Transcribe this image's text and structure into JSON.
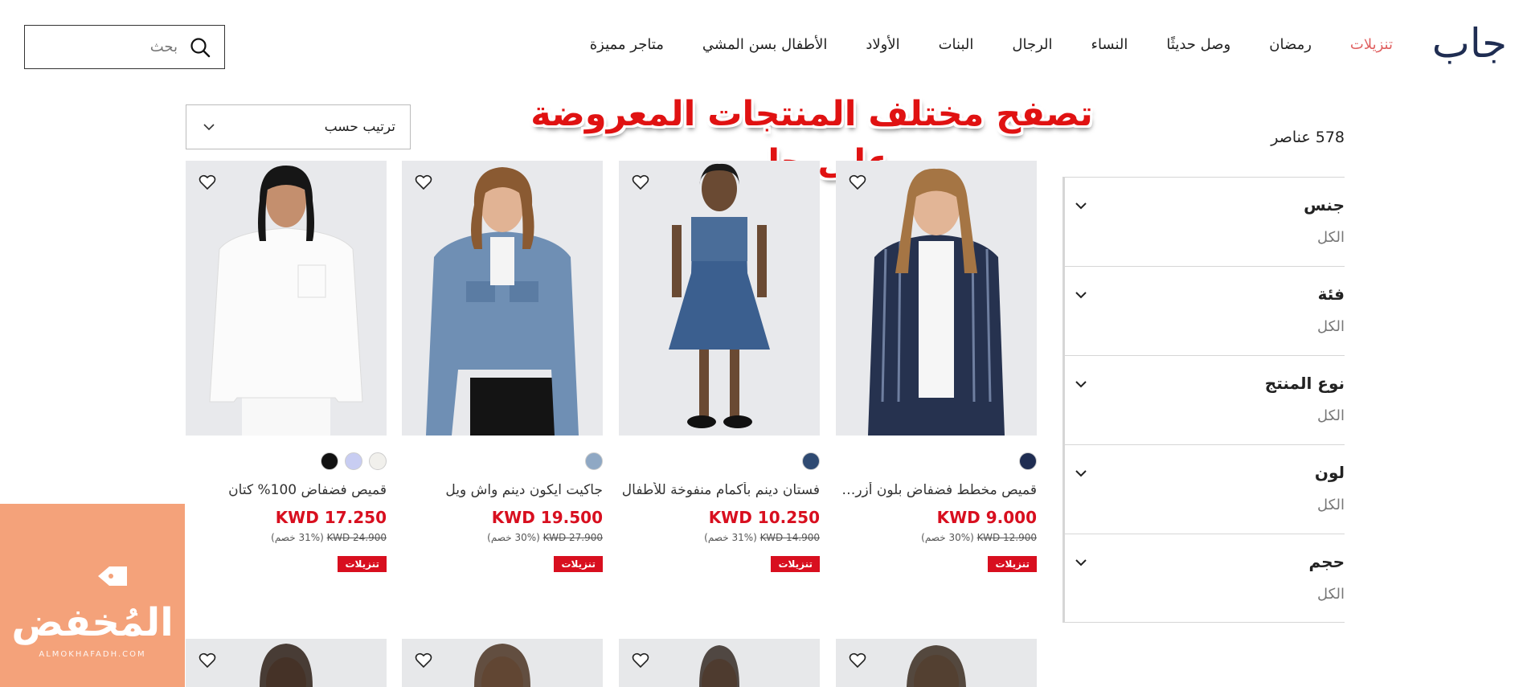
{
  "header": {
    "logo": "جاب",
    "nav": [
      {
        "label": "تنزيلات",
        "accent": "#e06060"
      },
      {
        "label": "رمضان"
      },
      {
        "label": "وصل حديثًا"
      },
      {
        "label": "النساء"
      },
      {
        "label": "الرجال"
      },
      {
        "label": "البنات"
      },
      {
        "label": "الأولاد"
      },
      {
        "label": "الأطفال بسن المشي"
      },
      {
        "label": "متاجر مميزة"
      }
    ],
    "search": {
      "placeholder": "بحث",
      "icon": "search-icon"
    }
  },
  "banner": {
    "text": "تصفح مختلف المنتجات المعروضة على جاب",
    "color": "#e01212"
  },
  "sort": {
    "label": "ترتيب حسب",
    "icon": "chevron-down-icon"
  },
  "results": {
    "count": "578 عناصر"
  },
  "filters": [
    {
      "title": "جنس",
      "value": "الكل"
    },
    {
      "title": "فئة",
      "value": "الكل"
    },
    {
      "title": "نوع المنتج",
      "value": "الكل"
    },
    {
      "title": "لون",
      "value": "الكل"
    },
    {
      "title": "حجم",
      "value": "الكل"
    }
  ],
  "products": [
    {
      "name": "قميص مخطط فضفاض بلون أزرق داكن",
      "price": "KWD 9.000",
      "old_price": "KWD 12.900",
      "discount": "(30% خصم)",
      "tag": "تنزيلات",
      "swatches": [
        "#1f2d52"
      ]
    },
    {
      "name": "فستان دينم بأكمام منفوخة للأطفال",
      "price": "KWD 10.250",
      "old_price": "KWD 14.900",
      "discount": "(31% خصم)",
      "tag": "تنزيلات",
      "swatches": [
        "#2f4a72"
      ]
    },
    {
      "name": "جاكيت ايكون دينم واش ويل",
      "price": "KWD 19.500",
      "old_price": "KWD 27.900",
      "discount": "(30% خصم)",
      "tag": "تنزيلات",
      "swatches": [
        "#8fa8c4"
      ]
    },
    {
      "name": "قميص فضفاض 100% كتان",
      "price": "KWD 17.250",
      "old_price": "KWD 24.900",
      "discount": "(31% خصم)",
      "tag": "تنزيلات",
      "swatches": [
        "#f1f0ec",
        "#c8cdf2",
        "#111111"
      ]
    }
  ],
  "watermark": {
    "text": "المُخفض",
    "sub": "ALMOKHAFADH.COM"
  },
  "colors": {
    "sale_red": "#d80f1f",
    "watermark_bg": "#f4a27a",
    "logo": "#1f2d52"
  }
}
